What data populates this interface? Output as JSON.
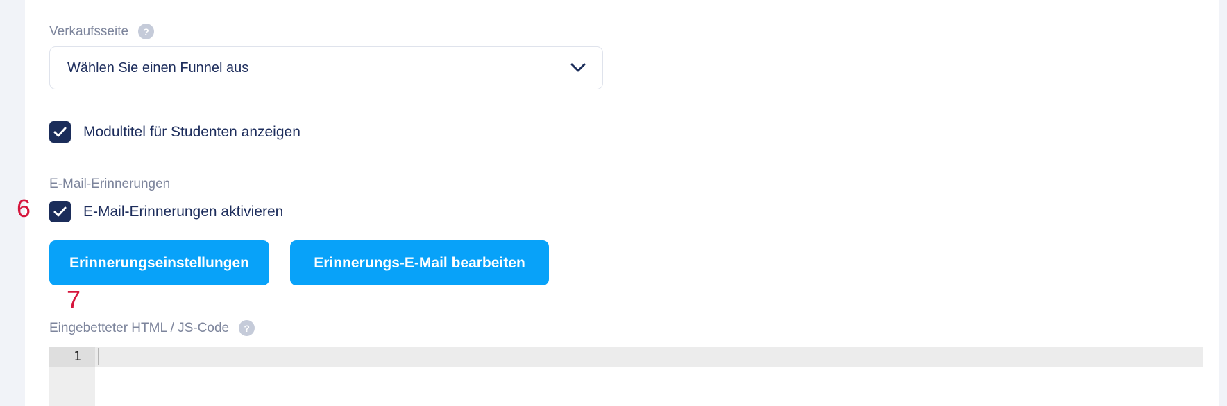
{
  "sales_page": {
    "label": "Verkaufsseite",
    "help_icon": "?",
    "select_value": "Wählen Sie einen Funnel aus"
  },
  "module_title": {
    "checked": true,
    "label": "Modultitel für Studenten anzeigen"
  },
  "email_reminders": {
    "section_label": "E-Mail-Erinnerungen",
    "checked": true,
    "checkbox_label": "E-Mail-Erinnerungen aktivieren",
    "settings_button": "Erinnerungseinstellungen",
    "edit_email_button": "Erinnerungs-E-Mail bearbeiten"
  },
  "embedded_code": {
    "label": "Eingebetteter HTML / JS-Code",
    "help_icon": "?",
    "line_numbers": [
      "1"
    ],
    "content": ""
  },
  "annotations": [
    "6",
    "7"
  ],
  "colors": {
    "primary_button": "#08a2f9",
    "checkbox": "#1b2d5a",
    "annotation": "#d6163d",
    "text": "#1d2d5c",
    "label": "#7d859c"
  }
}
